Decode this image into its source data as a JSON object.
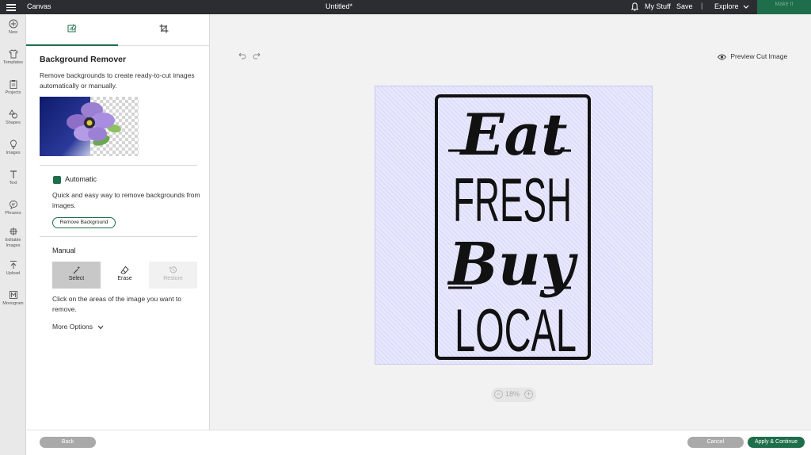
{
  "topbar": {
    "app_name": "Canvas",
    "document_title": "Untitled*",
    "my_stuff": "My Stuff",
    "save": "Save",
    "separator": "|",
    "explore": "Explore",
    "make_it": "Make It"
  },
  "rail": {
    "items": [
      {
        "label": "New",
        "icon": "plus-circle-icon"
      },
      {
        "label": "Templates",
        "icon": "shirt-icon"
      },
      {
        "label": "Projects",
        "icon": "clipboard-icon"
      },
      {
        "label": "Shapes",
        "icon": "shapes-icon"
      },
      {
        "label": "Images",
        "icon": "lightbulb-icon"
      },
      {
        "label": "Text",
        "icon": "text-t-icon"
      },
      {
        "label": "Phrases",
        "icon": "speech-bubble-icon"
      },
      {
        "label": "Editable Images",
        "icon": "editable-image-icon"
      },
      {
        "label": "Upload",
        "icon": "upload-arrow-icon"
      },
      {
        "label": "Monogram",
        "icon": "monogram-icon"
      }
    ]
  },
  "panel": {
    "tabs": [
      {
        "icon": "edit-image-icon",
        "active": true
      },
      {
        "icon": "crop-icon",
        "active": false
      }
    ],
    "title": "Background Remover",
    "description": "Remove backgrounds to create ready-to-cut images automatically or manually.",
    "automatic": {
      "title": "Automatic",
      "description": "Quick and easy way to remove backgrounds from images.",
      "button": "Remove Background"
    },
    "manual": {
      "title": "Manual",
      "tools": {
        "select": "Select",
        "erase": "Erase",
        "restore": "Restore"
      },
      "description": "Click on the areas of the image you want to remove.",
      "more_options": "More Options"
    }
  },
  "canvas": {
    "preview_label": "Preview Cut Image",
    "zoom_value": "18%",
    "artwork": {
      "line1": "Eat",
      "line2": "FRESH",
      "line3": "Buy",
      "line4": "LOCAL"
    }
  },
  "footer": {
    "back": "Back",
    "cancel": "Cancel",
    "apply": "Apply & Continue"
  },
  "colors": {
    "accent": "#1e6e4b",
    "topbar": "#2b2d30",
    "artboard": "#e7e7ff"
  }
}
